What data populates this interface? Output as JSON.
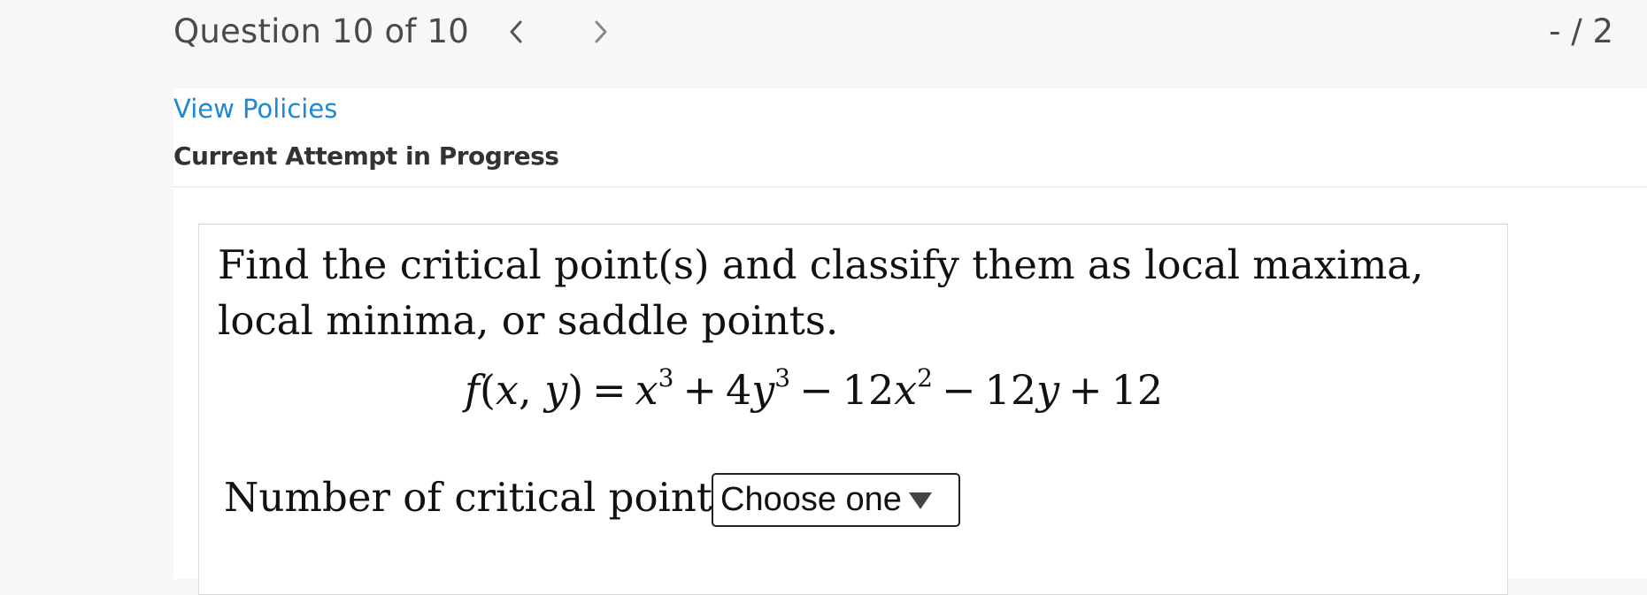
{
  "header": {
    "question_title": "Question 10 of 10",
    "prev_icon": "chevron-left-icon",
    "next_icon": "chevron-right-icon",
    "score": "- / 2"
  },
  "links": {
    "view_policies": "View Policies"
  },
  "status": {
    "attempt": "Current Attempt in Progress"
  },
  "question": {
    "prompt": "Find the critical point(s) and classify them as local maxima, local minima, or saddle points.",
    "formula_lhs": "f(x, y)",
    "formula_text": "f(x, y) = x^3 + 4y^3 − 12x^2 − 12y + 12",
    "count_label": "Number of critical points:",
    "select": {
      "selected": "Choose one",
      "icon": "dropdown-triangle-icon"
    }
  },
  "colors": {
    "link": "#1e88d2",
    "header_bg": "#f7f7f7",
    "text_dark": "#333333"
  }
}
